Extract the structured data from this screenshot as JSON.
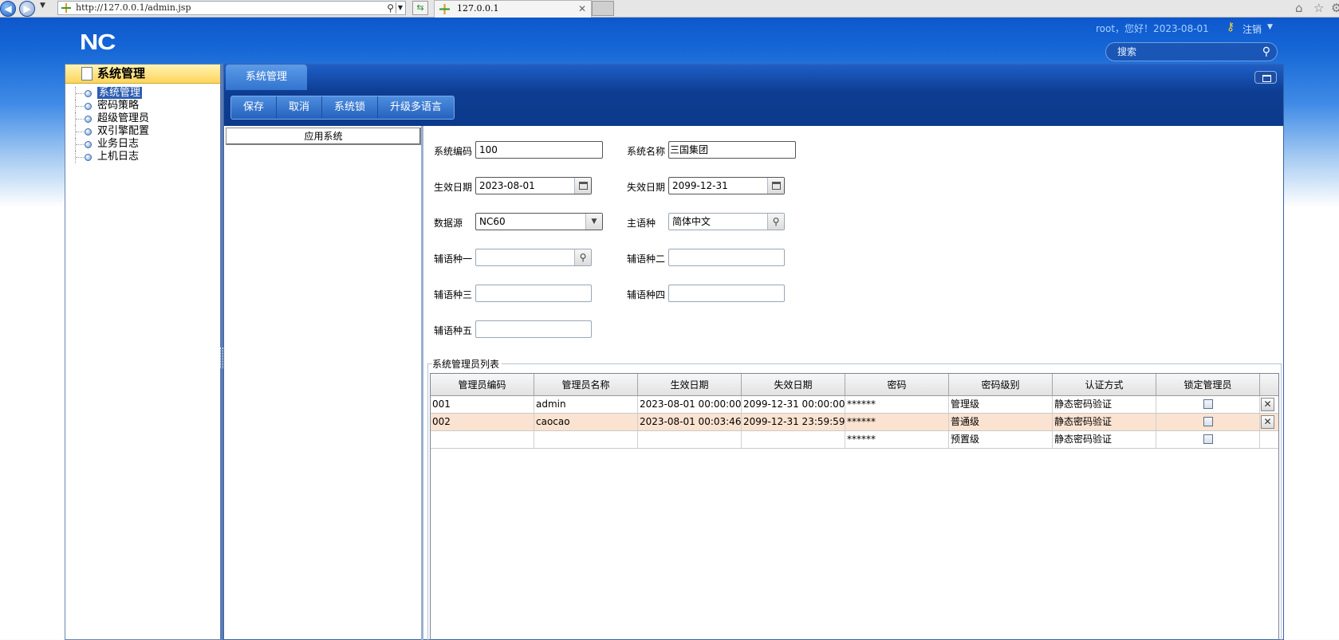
{
  "browser": {
    "url": "http://127.0.0.1/admin.jsp",
    "tab_title": "127.0.0.1"
  },
  "header": {
    "logo": "NC",
    "greeting": "root，您好！2023-08-01",
    "logout": "注销",
    "search_placeholder": "搜索"
  },
  "sidebar": {
    "title": "系统管理",
    "items": [
      {
        "label": "系统管理",
        "selected": true
      },
      {
        "label": "密码策略"
      },
      {
        "label": "超级管理员"
      },
      {
        "label": "双引擎配置"
      },
      {
        "label": "业务日志"
      },
      {
        "label": "上机日志"
      }
    ]
  },
  "main": {
    "tab": "系统管理",
    "toolbar": [
      "保存",
      "取消",
      "系统锁",
      "升级多语言"
    ],
    "app_column_header": "应用系统"
  },
  "form": {
    "sys_code_label": "系统编码",
    "sys_code": "100",
    "sys_name_label": "系统名称",
    "sys_name": "三国集团",
    "start_date_label": "生效日期",
    "start_date": "2023-08-01",
    "end_date_label": "失效日期",
    "end_date": "2099-12-31",
    "datasource_label": "数据源",
    "datasource": "NC60",
    "main_lang_label": "主语种",
    "main_lang": "简体中文",
    "aux1_label": "辅语种一",
    "aux1": "",
    "aux2_label": "辅语种二",
    "aux2": "",
    "aux3_label": "辅语种三",
    "aux3": "",
    "aux4_label": "辅语种四",
    "aux4": "",
    "aux5_label": "辅语种五",
    "aux5": ""
  },
  "admin_list": {
    "title": "系统管理员列表",
    "columns": [
      "管理员编码",
      "管理员名称",
      "生效日期",
      "失效日期",
      "密码",
      "密码级别",
      "认证方式",
      "锁定管理员"
    ],
    "rows": [
      {
        "code": "001",
        "name": "admin",
        "start": "2023-08-01 00:00:00",
        "end": "2099-12-31 00:00:00",
        "password": "******",
        "level": "管理级",
        "auth": "静态密码验证",
        "locked": false
      },
      {
        "code": "002",
        "name": "caocao",
        "start": "2023-08-01 00:03:46",
        "end": "2099-12-31 23:59:59",
        "password": "******",
        "level": "普通级",
        "auth": "静态密码验证",
        "locked": false
      },
      {
        "code": "",
        "name": "",
        "start": "",
        "end": "",
        "password": "******",
        "level": "预置级",
        "auth": "静态密码验证",
        "locked": false
      }
    ]
  },
  "icons": {
    "delete": "✕",
    "search": "search-icon",
    "calendar": "calendar-icon"
  }
}
